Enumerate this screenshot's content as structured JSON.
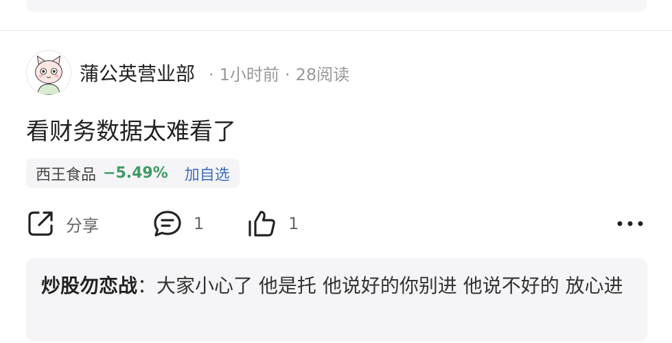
{
  "post": {
    "author": "蒲公英营业部",
    "time": "1小时前",
    "reads": "28阅读",
    "separator": "·",
    "content": "看财务数据太难看了",
    "stock": {
      "name": "西王食品",
      "change": "−5.49%",
      "add_label": "加自选",
      "change_color": "#3e9b63"
    }
  },
  "actions": {
    "share_label": "分享",
    "comment_count": "1",
    "like_count": "1"
  },
  "reply": {
    "author": "炒股勿恋战",
    "separator": "：",
    "text": "大家小心了 他是托 他说好的你别进 他说不好的 放心进"
  },
  "icons": {
    "share": "share-icon",
    "comment": "comment-icon",
    "like": "thumbs-up-icon",
    "more": "more-icon",
    "avatar": "cartoon-cat-avatar"
  }
}
